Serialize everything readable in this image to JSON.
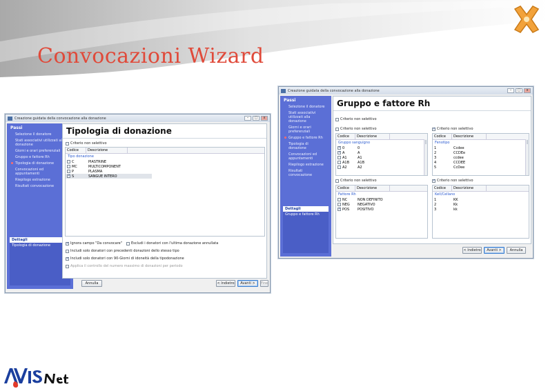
{
  "slide": {
    "title": "Convocazioni Wizard",
    "brand_logo": "AVIS Net",
    "accent_color": "#e04a3a"
  },
  "left_window": {
    "title": "Creazione guidata della convocazione alla donazione",
    "controls": [
      "–",
      "□",
      "x"
    ],
    "sidebar": {
      "header": "Passi",
      "steps": [
        "Selezione il donatore",
        "Stati associativi utilizzati alla donazione",
        "Giorni e orari preferenziali",
        "Gruppo e fattore Rh",
        "Tipologia di donazione",
        "Convocazioni ed appuntamenti",
        "Riepilogo estrazione",
        "Risultati convocazione"
      ],
      "current_step": 4,
      "details_header": "Dettagli",
      "details_value": "Tipologia di donazione"
    },
    "content": {
      "title": "Tipologia di donazione",
      "top_check": "Criterio non selettivo",
      "columns": [
        "Codice",
        "Descrizione"
      ],
      "group_label": "Tipo donazione",
      "rows": [
        {
          "checked": false,
          "code": "C",
          "desc": "PIASTRINE"
        },
        {
          "checked": false,
          "code": "MC",
          "desc": "MULTICOMPONENT"
        },
        {
          "checked": false,
          "code": "P",
          "desc": "PLASMA"
        },
        {
          "checked": true,
          "code": "S",
          "desc": "SANGUE INTERO"
        }
      ],
      "options": [
        {
          "checked": true,
          "label": "Ignora campo \"Da convocare\""
        },
        {
          "checked": false,
          "label": "Escludi i donatori con l'ultima donazione annullata"
        },
        {
          "checked": false,
          "label": "Includi solo donatori con precedenti donazioni dello stesso tipo"
        },
        {
          "checked": true,
          "label": "Includi solo donatori con 90-Giorni di idoneità della tipodonazione"
        },
        {
          "checked": false,
          "label": "Applica il controllo del numero massimo di donazioni per periodo"
        }
      ]
    },
    "buttons": {
      "cancel": "Annulla",
      "back": "< Indietro",
      "next": "Avanti >",
      "finish": "Fine"
    }
  },
  "right_window": {
    "title": "Creazione guidata della convocazione alla donazione",
    "controls": [
      "–",
      "□",
      "x"
    ],
    "sidebar": {
      "header": "Passi",
      "steps": [
        "Selezione il donatore",
        "Stati associativi utilizzati alla donazione",
        "Giorni e orari preferenziali",
        "Gruppo e fattore Rh",
        "Tipologia di donazione",
        "Convocazioni ed appuntamenti",
        "Riepilogo estrazione",
        "Risultati convocazione"
      ],
      "current_step": 3,
      "details_header": "Dettagli",
      "details_value": "Gruppo e fattore Rh"
    },
    "content": {
      "title": "Gruppo e fattore Rh",
      "top_left_check": "Criterio non selettivo",
      "left_grid": {
        "check": "Criterio non selettivo",
        "columns": [
          "Codice",
          "Descrizione"
        ],
        "group_label": "Gruppo sanguigno",
        "rows": [
          {
            "checked": true,
            "code": "0",
            "desc": "0"
          },
          {
            "checked": true,
            "code": "A",
            "desc": "A"
          },
          {
            "checked": false,
            "code": "A1",
            "desc": "A1"
          },
          {
            "checked": false,
            "code": "A1B",
            "desc": "A1B"
          },
          {
            "checked": false,
            "code": "A2",
            "desc": "A2"
          }
        ]
      },
      "right_grid": {
        "check": "Criterio non selettivo",
        "columns": [
          "Codice",
          "Descrizione"
        ],
        "group_label": "Fenotipo",
        "rows": [
          {
            "checked": false,
            "code": "1",
            "desc": "Ccdee"
          },
          {
            "checked": false,
            "code": "2",
            "desc": "CCDEe"
          },
          {
            "checked": false,
            "code": "3",
            "desc": "ccdee"
          },
          {
            "checked": false,
            "code": "4",
            "desc": "CCDEE"
          },
          {
            "checked": false,
            "code": "5",
            "desc": "CcDee"
          }
        ]
      },
      "bottom_left_check": "Criterio non selettivo",
      "bottom_right_check": "Criterio non selettivo",
      "rh_grid": {
        "columns": [
          "Codice",
          "Descrizione"
        ],
        "group_label": "Fattore Rh",
        "rows": [
          {
            "checked": false,
            "code": "NC",
            "desc": "NON DEFINITO"
          },
          {
            "checked": false,
            "code": "NEG",
            "desc": "NEGATIVO"
          },
          {
            "checked": true,
            "code": "POS",
            "desc": "POSITIVO"
          }
        ]
      },
      "kell_grid": {
        "columns": [
          "Codice",
          "Descrizione"
        ],
        "group_label": "Kell/Cellano",
        "rows": [
          {
            "checked": false,
            "code": "1",
            "desc": "KK"
          },
          {
            "checked": false,
            "code": "2",
            "desc": "Kk"
          },
          {
            "checked": false,
            "code": "3",
            "desc": "kk"
          }
        ]
      }
    },
    "buttons": {
      "back": "< Indietro",
      "next": "Avanti >",
      "cancel": "Annulla"
    }
  }
}
